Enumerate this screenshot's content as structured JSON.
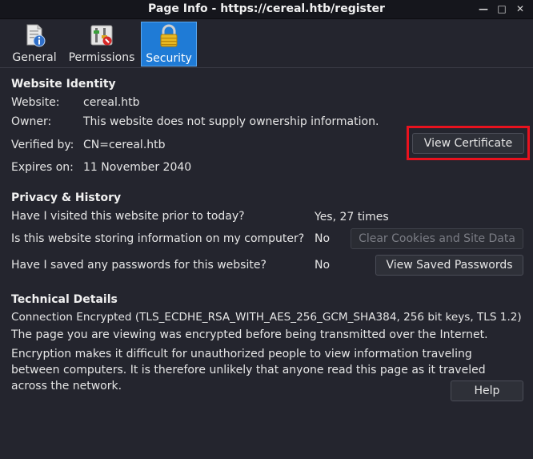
{
  "window": {
    "title": "Page Info - https://cereal.htb/register"
  },
  "tabs": [
    {
      "label": "General",
      "icon": "document-info-icon"
    },
    {
      "label": "Permissions",
      "icon": "permissions-icon"
    },
    {
      "label": "Security",
      "icon": "padlock-icon"
    }
  ],
  "identity": {
    "heading": "Website Identity",
    "website_label": "Website:",
    "website_value": "cereal.htb",
    "owner_label": "Owner:",
    "owner_value": "This website does not supply ownership information.",
    "verified_label": "Verified by:",
    "verified_value": "CN=cereal.htb",
    "expires_label": "Expires on:",
    "expires_value": "11 November 2040",
    "view_cert_label": "View Certificate"
  },
  "privacy": {
    "heading": "Privacy & History",
    "q_visited": "Have I visited this website prior to today?",
    "a_visited": "Yes, 27 times",
    "q_storing": "Is this website storing information on my computer?",
    "a_storing": "No",
    "clear_label": "Clear Cookies and Site Data",
    "q_passwords": "Have I saved any passwords for this website?",
    "a_passwords": "No",
    "view_passwords_label": "View Saved Passwords"
  },
  "technical": {
    "heading": "Technical Details",
    "connection": "Connection Encrypted (TLS_ECDHE_RSA_WITH_AES_256_GCM_SHA384, 256 bit keys, TLS 1.2)",
    "line1": "The page you are viewing was encrypted before being transmitted over the Internet.",
    "line2": "Encryption makes it difficult for unauthorized people to view information traveling between computers. It is therefore unlikely that anyone read this page as it traveled across the network.",
    "help_label": "Help"
  },
  "colors": {
    "background": "#24252e",
    "active_tab": "#1f7bd6",
    "highlight": "#e8121e"
  }
}
